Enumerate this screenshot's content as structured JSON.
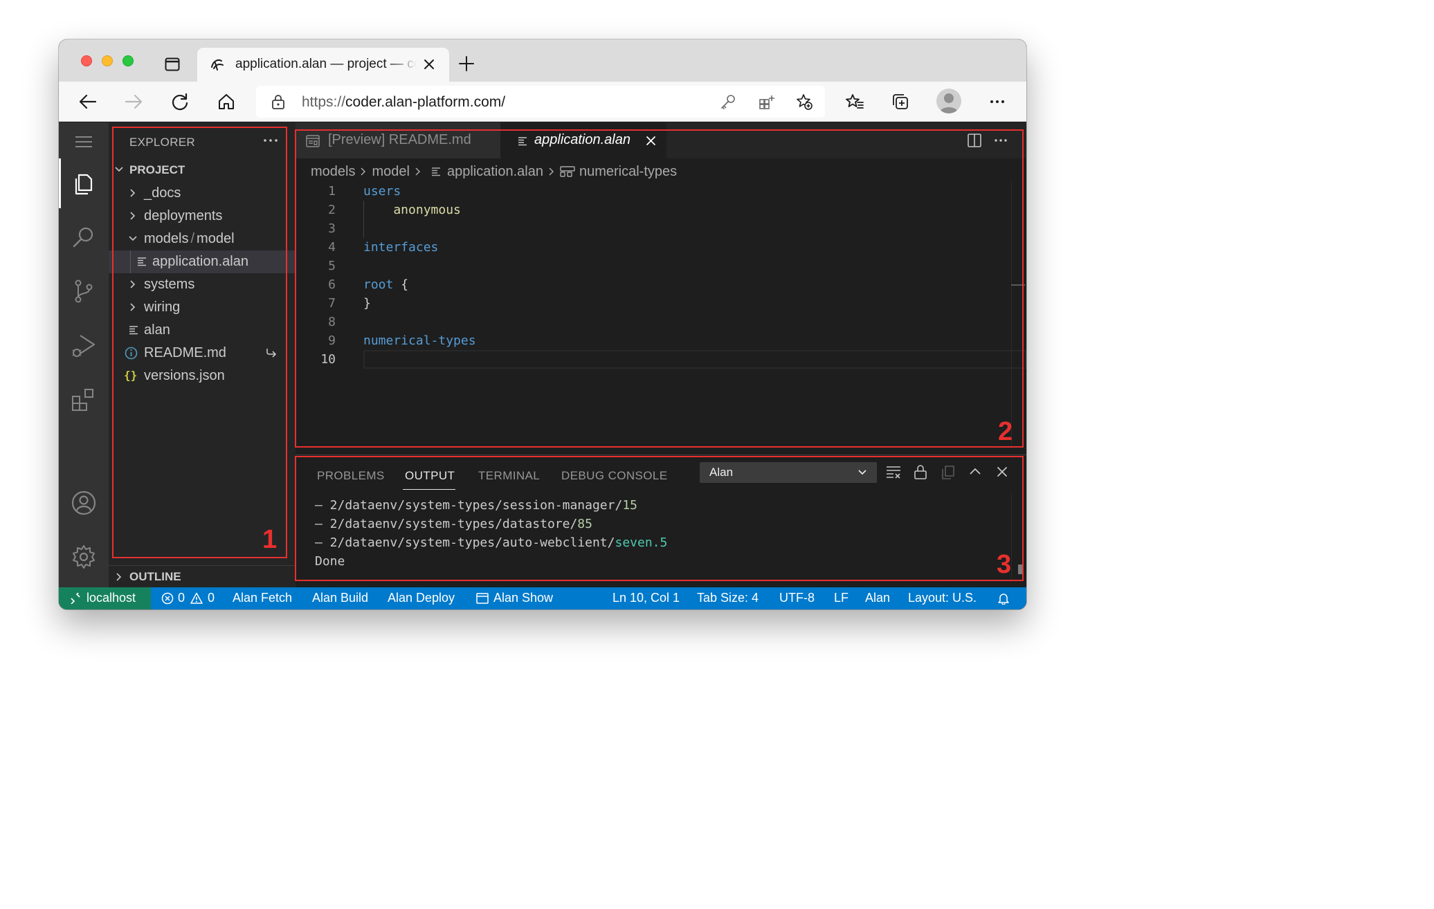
{
  "browser": {
    "tab_title": "application.alan — project — code-server",
    "url_scheme": "https://",
    "url_host": "coder.alan-platform.com/"
  },
  "sidebar": {
    "title": "EXPLORER",
    "project_label": "PROJECT",
    "items": [
      {
        "label": "_docs",
        "kind": "folder"
      },
      {
        "label": "deployments",
        "kind": "folder"
      },
      {
        "label_a": "models",
        "sep": "/",
        "label_b": "model",
        "kind": "folder-open"
      },
      {
        "label": "application.alan",
        "kind": "file-selected"
      },
      {
        "label": "systems",
        "kind": "folder"
      },
      {
        "label": "wiring",
        "kind": "folder"
      },
      {
        "label": "alan",
        "kind": "file"
      },
      {
        "label": "README.md",
        "kind": "info-file"
      },
      {
        "label": "versions.json",
        "kind": "json-file"
      }
    ],
    "outline_label": "OUTLINE"
  },
  "editor": {
    "tabs": [
      {
        "label": "[Preview] README.md",
        "active": false
      },
      {
        "label": "application.alan",
        "active": true
      }
    ],
    "breadcrumbs": [
      "models",
      "model",
      "application.alan",
      "numerical-types"
    ],
    "lines": [
      {
        "n": "1",
        "text": "users",
        "cls": "kw"
      },
      {
        "n": "2",
        "text": "    anonymous",
        "cls": "str"
      },
      {
        "n": "3",
        "text": "",
        "cls": "plain"
      },
      {
        "n": "4",
        "text": "interfaces",
        "cls": "kw"
      },
      {
        "n": "5",
        "text": "",
        "cls": "plain"
      },
      {
        "n": "6",
        "text_a": "root",
        "text_b": " {",
        "cls": "kw"
      },
      {
        "n": "7",
        "text": "}",
        "cls": "plain"
      },
      {
        "n": "8",
        "text": "",
        "cls": "plain"
      },
      {
        "n": "9",
        "text": "numerical-types",
        "cls": "kw"
      },
      {
        "n": "10",
        "text": "",
        "cls": "plain"
      }
    ]
  },
  "panel": {
    "tabs": [
      "PROBLEMS",
      "OUTPUT",
      "TERMINAL",
      "DEBUG CONSOLE"
    ],
    "active_tab": "OUTPUT",
    "channel": "Alan",
    "output": [
      {
        "prefix": "– 2/dataenv/system-types/session-manager/",
        "num": "15"
      },
      {
        "prefix": "– 2/dataenv/system-types/datastore/",
        "num": "85"
      },
      {
        "prefix": "– 2/dataenv/system-types/auto-webclient/",
        "green": "seven.5"
      },
      {
        "prefix": "Done"
      }
    ]
  },
  "status": {
    "remote": "localhost",
    "errors": "0",
    "warnings": "0",
    "fetch": "Alan Fetch",
    "build": "Alan Build",
    "deploy": "Alan Deploy",
    "show": "Alan Show",
    "position": "Ln 10, Col 1",
    "tab_size": "Tab Size: 4",
    "encoding": "UTF-8",
    "eol": "LF",
    "language": "Alan",
    "layout": "Layout: U.S."
  },
  "annotations": [
    "1",
    "2",
    "3"
  ],
  "colors": {
    "annotation": "#e8302e",
    "statusbar": "#007acc",
    "remote": "#16825d",
    "keyword": "#569cd6",
    "string": "#dcdcaa",
    "number": "#b5cea8",
    "green": "#4ec9b0"
  }
}
